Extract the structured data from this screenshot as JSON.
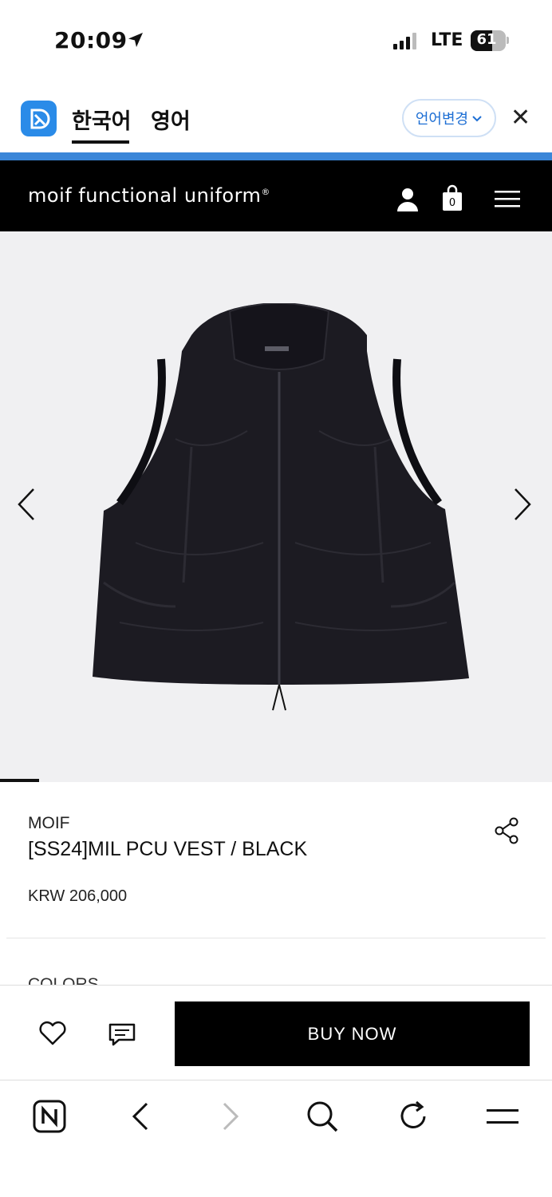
{
  "status_bar": {
    "time": "20:09",
    "network": "LTE",
    "battery": "61",
    "battery_level": 0.61
  },
  "translate_bar": {
    "tabs": [
      "한국어",
      "영어"
    ],
    "active_tab": "한국어",
    "language_button": "언어변경",
    "close_label": "✕"
  },
  "site_header": {
    "brand": "moif functional uniform",
    "brand_mark": "®",
    "cart_count": "0"
  },
  "product": {
    "brand": "MOIF",
    "name": "[SS24]MIL PCU VEST / BLACK",
    "price": "KRW 206,000",
    "section_label": "COLORS"
  },
  "purchase_bar": {
    "buy_label": "BUY NOW"
  },
  "colors": {
    "accent_blue": "#3b86d8",
    "header_black": "#000000",
    "gallery_bg": "#f0f0f2"
  }
}
